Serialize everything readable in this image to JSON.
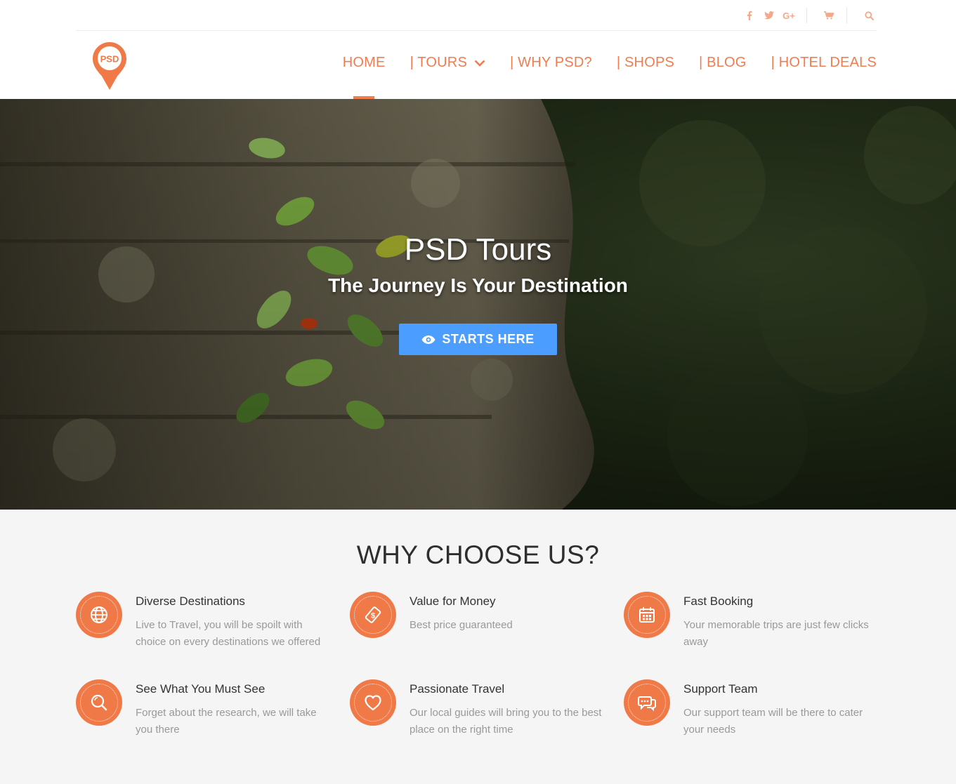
{
  "topbar": {
    "icons": [
      "facebook-icon",
      "twitter-icon",
      "google-plus-icon",
      "cart-icon",
      "search-icon"
    ],
    "google_plus_label": "G+"
  },
  "brand": {
    "logo_text": "PSD",
    "color": "#f07c50"
  },
  "nav": {
    "items": [
      {
        "label": "HOME",
        "active": true
      },
      {
        "label": "| TOURS",
        "has_dropdown": true
      },
      {
        "label": "| WHY PSD?"
      },
      {
        "label": "| SHOPS"
      },
      {
        "label": "| BLOG"
      },
      {
        "label": "| HOTEL DEALS"
      }
    ]
  },
  "hero": {
    "title": "PSD Tours",
    "subtitle": "The Journey Is Your Destination",
    "cta_label": "STARTS HERE",
    "cta_color": "#4b9dff"
  },
  "why": {
    "title": "WHY CHOOSE US?",
    "accent": "#f07a47",
    "features": [
      {
        "icon": "globe-icon",
        "title": "Diverse Destinations",
        "desc": "Live to Travel, you will be spoilt with choice on every destinations we offered"
      },
      {
        "icon": "money-tag-icon",
        "title": "Value for Money",
        "desc": "Best price guaranteed"
      },
      {
        "icon": "calendar-icon",
        "title": "Fast Booking",
        "desc": "Your memorable trips are just few clicks away"
      },
      {
        "icon": "magnifier-icon",
        "title": "See What You Must See",
        "desc": "Forget about the research, we will take you there"
      },
      {
        "icon": "heart-icon",
        "title": "Passionate Travel",
        "desc": "Our local guides will bring you to the best place on the right time"
      },
      {
        "icon": "chat-bubbles-icon",
        "title": "Support Team",
        "desc": "Our support team will be there to cater your needs"
      }
    ]
  }
}
